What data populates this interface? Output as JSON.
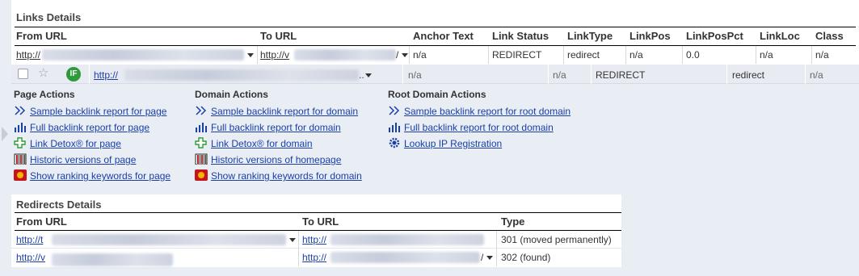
{
  "links": {
    "title": "Links Details",
    "headers": {
      "from_url": "From URL",
      "to_url": "To URL",
      "anchor_text": "Anchor Text",
      "link_status": "Link Status",
      "link_type": "LinkType",
      "link_pos": "LinkPos",
      "link_pos_pct": "LinkPosPct",
      "link_loc": "LinkLoc",
      "class": "Class"
    },
    "row": {
      "from_url": "http://",
      "to_url": "http://v",
      "anchor_text": "n/a",
      "link_status": "REDIRECT",
      "link_type": "redirect",
      "link_pos": "n/a",
      "link_pos_pct": "0.0",
      "link_loc": "n/a",
      "class": "n/a"
    },
    "row2": {
      "badge": "IF",
      "url": "http://",
      "url_suffix": "..",
      "anchor_text": "n/a",
      "col2": "n/a",
      "status": "REDIRECT",
      "type": "redirect",
      "class": "n/a"
    }
  },
  "actions": {
    "page": {
      "title": "Page Actions",
      "items": [
        {
          "label": "Sample backlink report for page",
          "icon": "double-chevron-icon"
        },
        {
          "label": "Full backlink report for page",
          "icon": "bar-chart-icon"
        },
        {
          "label": "Link Detox® for page",
          "icon": "plus-cross-icon"
        },
        {
          "label": "Historic versions of page",
          "icon": "archive-icon"
        },
        {
          "label": "Show ranking keywords for page",
          "icon": "keywords-icon"
        }
      ]
    },
    "domain": {
      "title": "Domain Actions",
      "items": [
        {
          "label": "Sample backlink report for domain",
          "icon": "double-chevron-icon"
        },
        {
          "label": "Full backlink report for domain",
          "icon": "bar-chart-icon"
        },
        {
          "label": "Link Detox® for domain",
          "icon": "plus-cross-icon"
        },
        {
          "label": "Historic versions of homepage",
          "icon": "archive-icon"
        },
        {
          "label": "Show ranking keywords for domain",
          "icon": "keywords-icon"
        }
      ]
    },
    "root": {
      "title": "Root Domain Actions",
      "items": [
        {
          "label": "Sample backlink report for root domain",
          "icon": "double-chevron-icon"
        },
        {
          "label": "Full backlink report for root domain",
          "icon": "bar-chart-icon"
        },
        {
          "label": "Lookup IP Registration",
          "icon": "gear-icon"
        }
      ]
    }
  },
  "redirects": {
    "title": "Redirects Details",
    "headers": {
      "from_url": "From URL",
      "to_url": "To URL",
      "type": "Type"
    },
    "rows": [
      {
        "from_url": "http://t",
        "to_url": "http://",
        "type": "301 (moved permanently)"
      },
      {
        "from_url": "http://v",
        "to_url": "http://",
        "to_suffix": "/",
        "type": "302 (found)"
      }
    ]
  },
  "colors": {
    "link": "#1a3fa8",
    "background": "#e9edf4",
    "badge_green": "#2e9b3a"
  }
}
